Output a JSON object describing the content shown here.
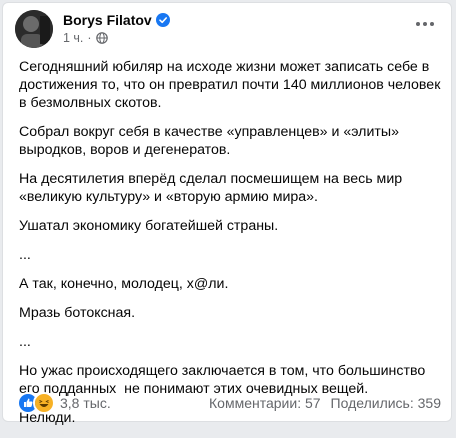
{
  "post": {
    "author": "Borys Filatov",
    "time": "1 ч.",
    "separator": "·",
    "paragraphs": [
      "Сегодняшний юбиляр на исходе жизни может записать себе в достижения то, что он превратил почти 140 миллионов человек в безмолвных скотов.",
      "Собрал вокруг себя в качестве «управленцев» и «элиты» выродков, воров и дегенератов.",
      "На десятилетия вперёд сделал посмешищем на весь мир «великую культуру» и «вторую армию мира».",
      "Ушатал экономику богатейшей страны.",
      "...",
      "А так, конечно, молодец, х@ли.",
      "Мразь ботоксная.",
      "...",
      "Но ужас происходящего заключается в том, что большинство его подданных  не понимают этих очевидных вещей.",
      "Нелюди."
    ]
  },
  "stats": {
    "reactions_count": "3,8 тыс.",
    "comments": "Комментарии: 57",
    "shares": "Поделились: 359"
  },
  "colors": {
    "like": "#1877f2",
    "haha": "#f7b125",
    "verified": "#1877f2"
  }
}
